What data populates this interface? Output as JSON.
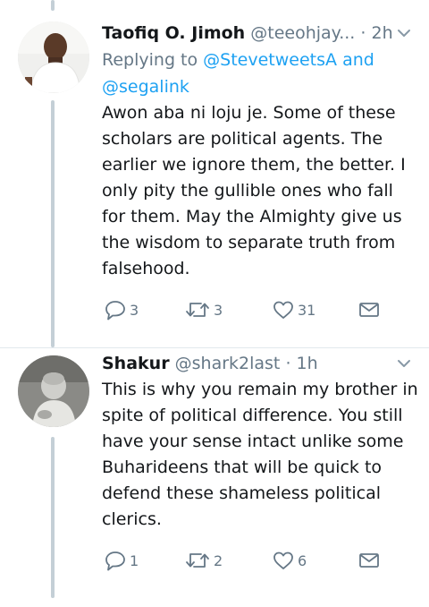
{
  "tweets": [
    {
      "name": "Taofiq O. Jimoh",
      "handle": "@teeohjay...",
      "separator": "·",
      "time": "2h",
      "reply_prefix": "Replying to",
      "reply_user1": "@StevetweetsA",
      "reply_and": "and",
      "reply_user2": "@segalink",
      "text": "Awon aba ni loju je. Some of these scholars are political agents. The earlier we ignore them, the better. I only pity the gullible ones who fall for them. May the Almighty give us the wisdom to separate truth from falsehood.",
      "replies": "3",
      "retweets": "3",
      "likes": "31"
    },
    {
      "name": "Shakur",
      "handle": "@shark2last",
      "separator": "·",
      "time": "1h",
      "text": "This is why you remain my brother in spite of political difference. You still have your sense intact unlike some Buharideens that will be quick to defend these shameless political clerics.",
      "replies": "1",
      "retweets": "2",
      "likes": "6"
    }
  ],
  "icons": {
    "reply": "reply-icon",
    "retweet": "retweet-icon",
    "like": "heart-icon",
    "dm": "envelope-icon",
    "more": "chevron-down-icon"
  },
  "colors": {
    "text": "#14171a",
    "muted": "#657786",
    "link": "#1da1f2",
    "thread_line": "#c4cfd6",
    "divider": "#e1e8ed"
  }
}
